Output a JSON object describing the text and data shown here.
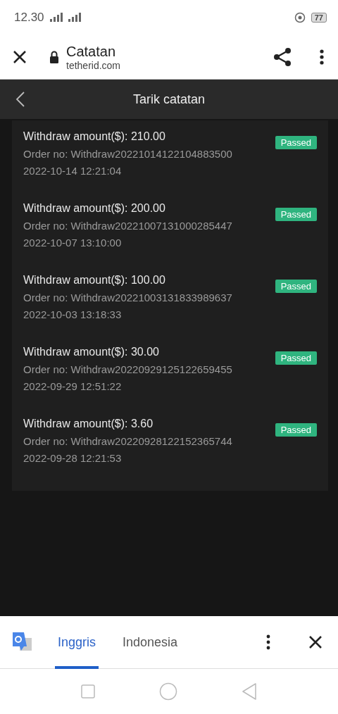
{
  "status_bar": {
    "time": "12.30",
    "battery": "77"
  },
  "browser_bar": {
    "title": "Catatan",
    "domain": "tetherid.com"
  },
  "page_header": {
    "title": "Tarik catatan"
  },
  "records": [
    {
      "amount": "Withdraw amount($): 210.00",
      "order_no": "Order no: Withdraw20221014122104883500",
      "date": "2022-10-14 12:21:04",
      "status": "Passed"
    },
    {
      "amount": "Withdraw amount($): 200.00",
      "order_no": "Order no: Withdraw20221007131000285447",
      "date": "2022-10-07 13:10:00",
      "status": "Passed"
    },
    {
      "amount": "Withdraw amount($): 100.00",
      "order_no": "Order no: Withdraw20221003131833989637",
      "date": "2022-10-03 13:18:33",
      "status": "Passed"
    },
    {
      "amount": "Withdraw amount($): 30.00",
      "order_no": "Order no: Withdraw20220929125122659455",
      "date": "2022-09-29 12:51:22",
      "status": "Passed"
    },
    {
      "amount": "Withdraw amount($): 3.60",
      "order_no": "Order no: Withdraw20220928122152365744",
      "date": "2022-09-28 12:21:53",
      "status": "Passed"
    }
  ],
  "translate_bar": {
    "tabs": [
      {
        "label": "Inggris",
        "selected": true
      },
      {
        "label": "Indonesia",
        "selected": false
      }
    ]
  }
}
